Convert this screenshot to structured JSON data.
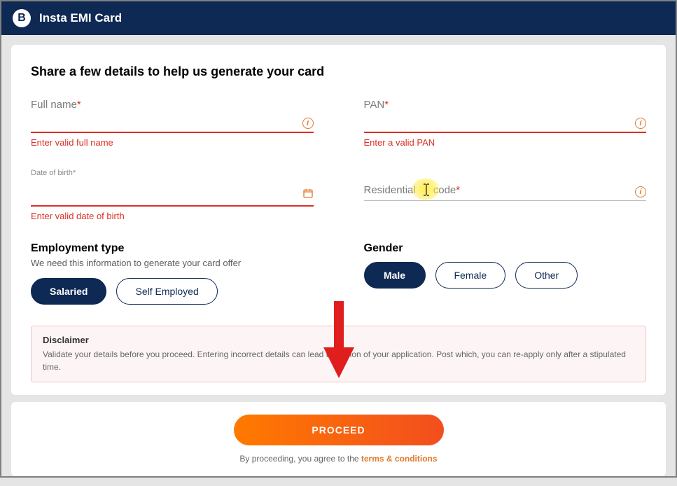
{
  "header": {
    "logo_letter": "B",
    "title": "Insta EMI Card"
  },
  "form": {
    "heading": "Share a few details to help us generate your card",
    "full_name": {
      "label": "Full name",
      "error": "Enter valid full name"
    },
    "pan": {
      "label": "PAN",
      "error": "Enter a valid PAN"
    },
    "dob": {
      "label": "Date of birth*",
      "error": "Enter valid date of birth"
    },
    "pincode": {
      "label_a": "Residential ",
      "label_b": " code"
    },
    "employment": {
      "title": "Employment type",
      "subtitle": "We need this information to generate your card offer",
      "options": [
        "Salaried",
        "Self Employed"
      ],
      "selected": "Salaried"
    },
    "gender": {
      "title": "Gender",
      "options": [
        "Male",
        "Female",
        "Other"
      ],
      "selected": "Male"
    }
  },
  "disclaimer": {
    "title": "Disclaimer",
    "body_a": "Validate your details before you proceed. Entering incorrect details can lead to r",
    "body_b": "ion of your application. Post which, you can re-apply only after a stipulated time."
  },
  "footer": {
    "proceed": "PROCEED",
    "agree_prefix": "By proceeding, you agree to the ",
    "tc": "terms & conditions"
  },
  "colors": {
    "primary": "#0d2954",
    "accent": "#ff7a00",
    "error": "#d93025"
  }
}
